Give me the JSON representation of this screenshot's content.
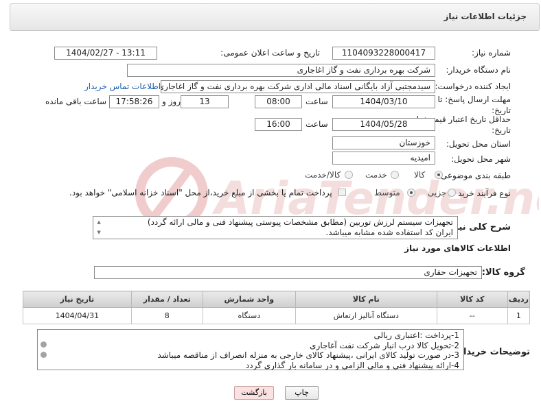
{
  "panel": {
    "title": "جزئیات اطلاعات نیاز"
  },
  "need": {
    "number_label": "شماره نیاز:",
    "number": "1104093228000417",
    "announce_label": "تاریخ و ساعت اعلان عمومی:",
    "announce": "1404/02/27 - 13:11",
    "buyer_label": "نام دستگاه خریدار:",
    "buyer": "شرکت بهره برداری نفت و گاز اغاجاری",
    "creator_label": "ایجاد کننده درخواست:",
    "creator": "سیدمجتبی آزاد بایگانی اسناد مالی اداری شرکت بهره برداری نفت و گاز اغاجاری",
    "contact_link": "اطلاعات تماس خریدار",
    "reply_label": "مهلت ارسال پاسخ: تا تاریخ:",
    "reply_date": "1404/03/10",
    "hour_label": "ساعت",
    "reply_time": "08:00",
    "days": "13",
    "days_label": "روز و",
    "remaining": "17:58:26",
    "remaining_label": "ساعت باقی مانده",
    "price_label": "حداقل تاریخ اعتبار قیمت: تا تاریخ:",
    "price_date": "1404/05/28",
    "price_time": "16:00",
    "province_label": "استان محل تحویل:",
    "province": "خوزستان",
    "city_label": "شهر محل تحویل:",
    "city": "امیدیه",
    "category_label": "طبقه بندی موضوعی:",
    "category_options": [
      "کالا",
      "خدمت",
      "کالا/خدمت"
    ],
    "process_label": "نوع فرآیند خرید :",
    "process_options": [
      "جزیی",
      "متوسط"
    ],
    "payment_note": "پرداخت تمام یا بخشی از مبلغ خرید،از محل \"اسناد خزانه اسلامی\" خواهد بود."
  },
  "summary": {
    "label": "شرح کلی نیاز:",
    "line1": "تجهیزات سیستم لرزش توربین (مطابق مشخصات پیوستی پیشنهاد فنی و مالی ارائه گردد)",
    "line2": "ایران کد استفاده شده مشابه میباشد."
  },
  "goods": {
    "section_title": "اطلاعات کالاهای مورد نیاز",
    "group_label": "گروه کالا:",
    "group": "تجهیزات حفاری",
    "columns": [
      "ردیف",
      "کد کالا",
      "نام کالا",
      "واحد شمارش",
      "تعداد / مقدار",
      "تاریخ نیاز"
    ],
    "rows": [
      {
        "row": "1",
        "code": "--",
        "name": "دستگاه آنالیز ارتعاش",
        "unit": "دستگاه",
        "qty": "8",
        "date": "1404/04/31"
      }
    ]
  },
  "buyer_notes": {
    "label": "توضیحات خریدار:",
    "lines": [
      "1-پرداخت :اعتباری ریالی",
      "2-تحویل کالا درب انبار شرکت نفت آغاجاری",
      "3-در صورت تولید کالای ایرانی ،پیشنهاد کالای خارجی به منزله انصراف از مناقصه میباشد",
      "4-ارائه پیشنهاد فنی و مالی الزامی و در سامانه بار گذاری گردد"
    ]
  },
  "buttons": {
    "print": "چاپ",
    "back": "بازگشت"
  },
  "watermark": {
    "text": "AriaTender.neT"
  },
  "colors": {
    "link": "#1a5fb4",
    "back_button": "#fbe2e2",
    "watermark": "#e6b8b8"
  }
}
